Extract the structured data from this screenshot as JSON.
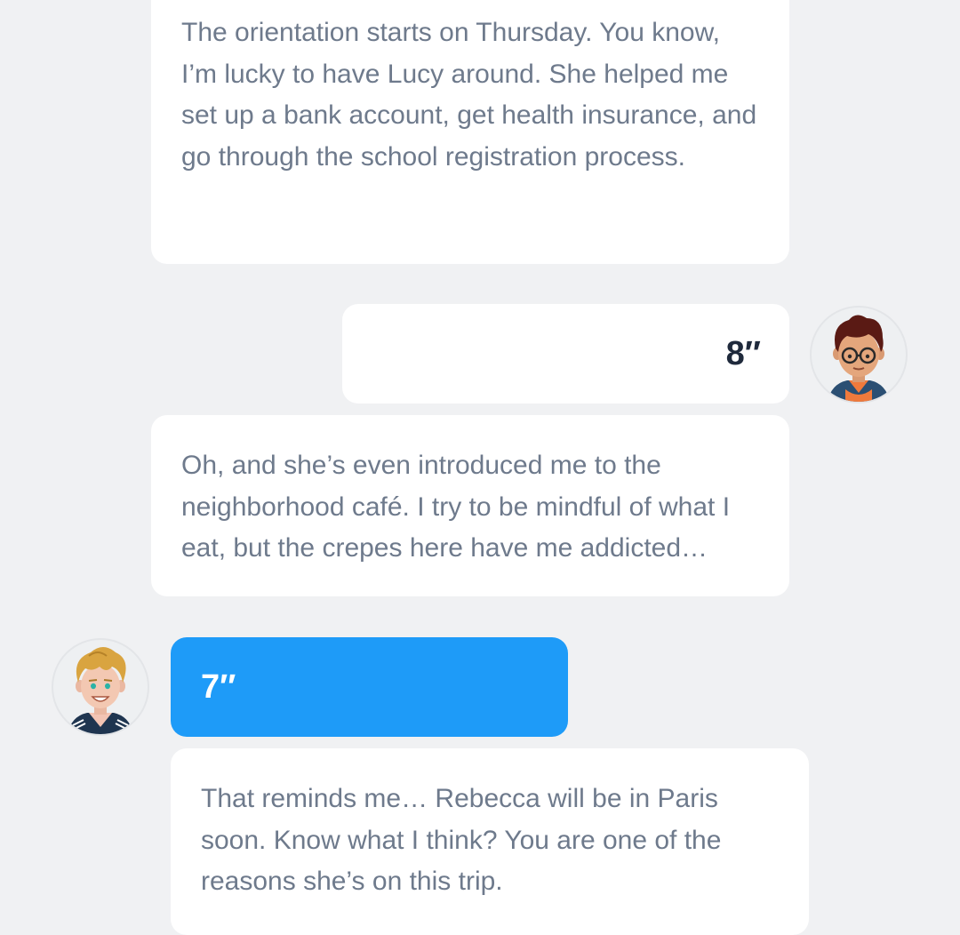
{
  "messages": [
    {
      "type": "translation",
      "text": "The orientation starts on Thursday. You know, I’m lucky to have Lucy around. She helped me set up a bank account, get health insurance, and go through the school registration process."
    },
    {
      "type": "audio",
      "side": "right",
      "duration": "8″",
      "avatar": "boy-with-glasses-avatar"
    },
    {
      "type": "translation",
      "text": "Oh, and she’s even introduced me to the neighborhood café. I try to be mindful of what I eat, but the crepes here have me addicted…"
    },
    {
      "type": "audio",
      "side": "left",
      "duration": "7″",
      "avatar": "blond-boy-avatar",
      "color": "#1e9bf8"
    },
    {
      "type": "translation",
      "text": "That reminds me… Rebecca will be in Paris soon. Know what I think? You are one of the reasons she’s on this trip."
    }
  ],
  "colors": {
    "background": "#f0f1f3",
    "bubble": "#ffffff",
    "text": "#6e7a8c",
    "accent": "#1e9bf8"
  }
}
